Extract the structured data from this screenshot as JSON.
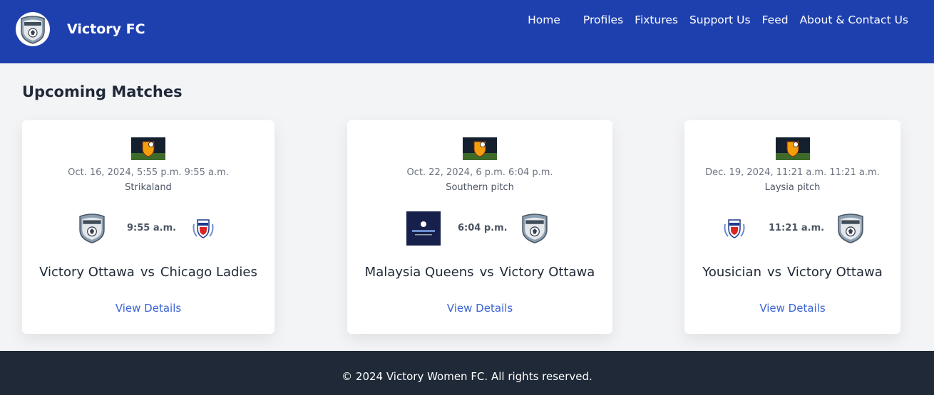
{
  "header": {
    "brand": "Victory FC",
    "logo_icon": "victory-crest-icon",
    "nav": [
      "Home",
      "Profiles",
      "Fixtures",
      "Support Us",
      "Feed",
      "About & Contact Us"
    ]
  },
  "main": {
    "title": "Upcoming Matches",
    "matches": [
      {
        "date": "Oct. 16, 2024, 5:55 p.m. 9:55 a.m.",
        "venue": "Strikaland",
        "time": "9:55 a.m.",
        "home": "Victory Ottawa",
        "vs": "vs",
        "away": "Chicago Ladies",
        "details": "View Details",
        "competition_icon": "competition-badge-icon",
        "home_icon": "victory-crest-icon",
        "away_icon": "chicago-crest-icon"
      },
      {
        "date": "Oct. 22, 2024, 6 p.m. 6:04 p.m.",
        "venue": "Southern pitch",
        "time": "6:04 p.m.",
        "home": "Malaysia Queens",
        "vs": "vs",
        "away": "Victory Ottawa",
        "details": "View Details",
        "competition_icon": "competition-badge-icon",
        "home_icon": "malaysia-queens-logo-icon",
        "away_icon": "victory-crest-icon"
      },
      {
        "date": "Dec. 19, 2024, 11:21 a.m. 11:21 a.m.",
        "venue": "Laysia pitch",
        "time": "11:21 a.m.",
        "home": "Yousician",
        "vs": "vs",
        "away": "Victory Ottawa",
        "details": "View Details",
        "competition_icon": "competition-badge-icon",
        "home_icon": "yousician-crest-icon",
        "away_icon": "victory-crest-icon"
      }
    ]
  },
  "footer": {
    "text": "© 2024 Victory Women FC. All rights reserved."
  },
  "colors": {
    "header_bg": "#1e40af",
    "page_bg": "#f3f4f6",
    "footer_bg": "#1f2937",
    "link": "#3b64d4"
  }
}
